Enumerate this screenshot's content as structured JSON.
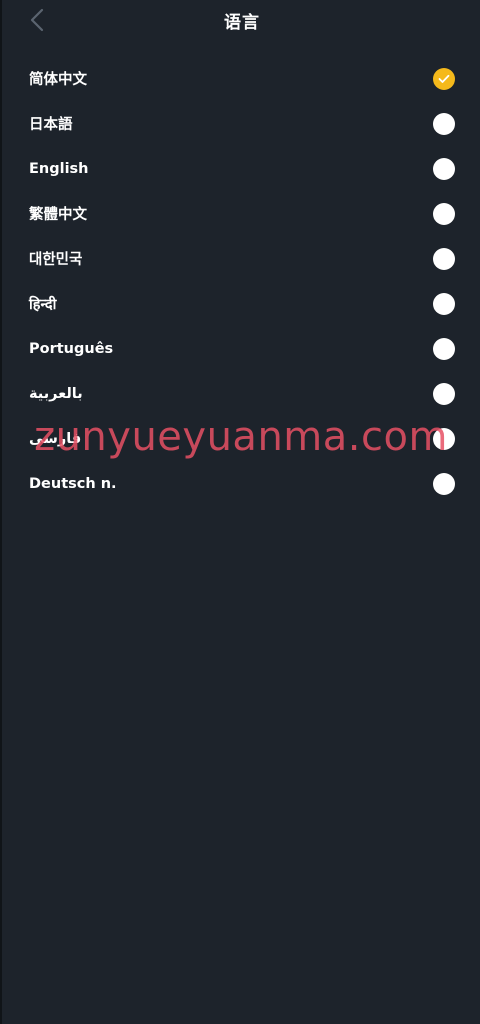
{
  "header": {
    "title": "语言",
    "back_icon": "chevron-left-icon"
  },
  "languages": [
    {
      "label": "简体中文",
      "selected": true
    },
    {
      "label": "日本語",
      "selected": false
    },
    {
      "label": "English",
      "selected": false
    },
    {
      "label": "繁體中文",
      "selected": false
    },
    {
      "label": "대한민국",
      "selected": false
    },
    {
      "label": "हिन्दी",
      "selected": false
    },
    {
      "label": "Português",
      "selected": false
    },
    {
      "label": "بالعربية",
      "selected": false
    },
    {
      "label": "فارسی",
      "selected": false
    },
    {
      "label": "Deutsch n.",
      "selected": false
    }
  ],
  "watermark": "zunyueyuanma.com",
  "colors": {
    "background": "#1d232b",
    "accent": "#f5b91b",
    "radio": "#ffffff"
  }
}
